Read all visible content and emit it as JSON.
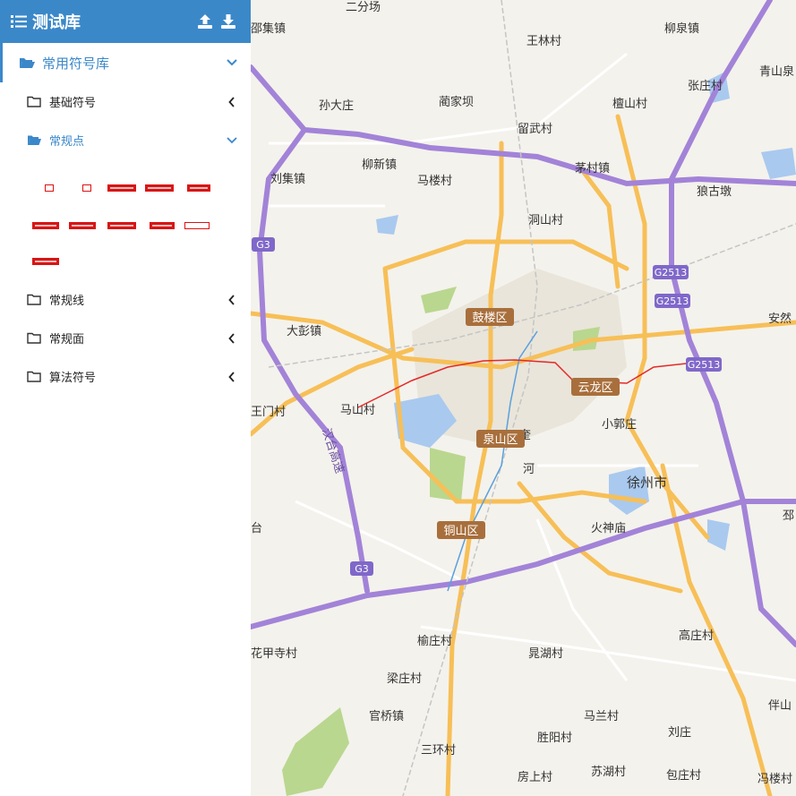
{
  "sidebar": {
    "title": "测试库",
    "group": {
      "label": "常用符号库",
      "expanded": true
    },
    "categories": [
      {
        "label": "基础符号",
        "expanded": false
      },
      {
        "label": "常规点",
        "expanded": true
      },
      {
        "label": "常规线",
        "expanded": false
      },
      {
        "label": "常规面",
        "expanded": false
      },
      {
        "label": "算法符号",
        "expanded": false
      }
    ],
    "symbol_count": 11,
    "accent_color": "#3b88c9",
    "symbol_color": "#d41818"
  },
  "map": {
    "places": [
      "二分场",
      "王林村",
      "柳泉镇",
      "青山泉",
      "邵集镇",
      "张庄村",
      "孙大庄",
      "蔺家坝",
      "檀山村",
      "留武村",
      "柳新镇",
      "茅村镇",
      "刘集镇",
      "马楼村",
      "狼古墩",
      "洞山村",
      "大彭镇",
      "安然",
      "马山村",
      "王门村",
      "小郭庄",
      "徐州市",
      "火神庙",
      "邳",
      "汉台高速",
      "榆庄村",
      "晁湖村",
      "高庄村",
      "花甲寺村",
      "梁庄村",
      "官桥镇",
      "马兰村",
      "伴山",
      "刘庄",
      "胜阳村",
      "三环村",
      "房上村",
      "苏湖村",
      "包庄村",
      "冯楼村",
      "河",
      "奎",
      "台"
    ],
    "districts": [
      "鼓楼区",
      "云龙区",
      "泉山区",
      "铜山区"
    ],
    "highways": [
      "G3",
      "G3",
      "G2513",
      "G2513",
      "G2513"
    ]
  }
}
